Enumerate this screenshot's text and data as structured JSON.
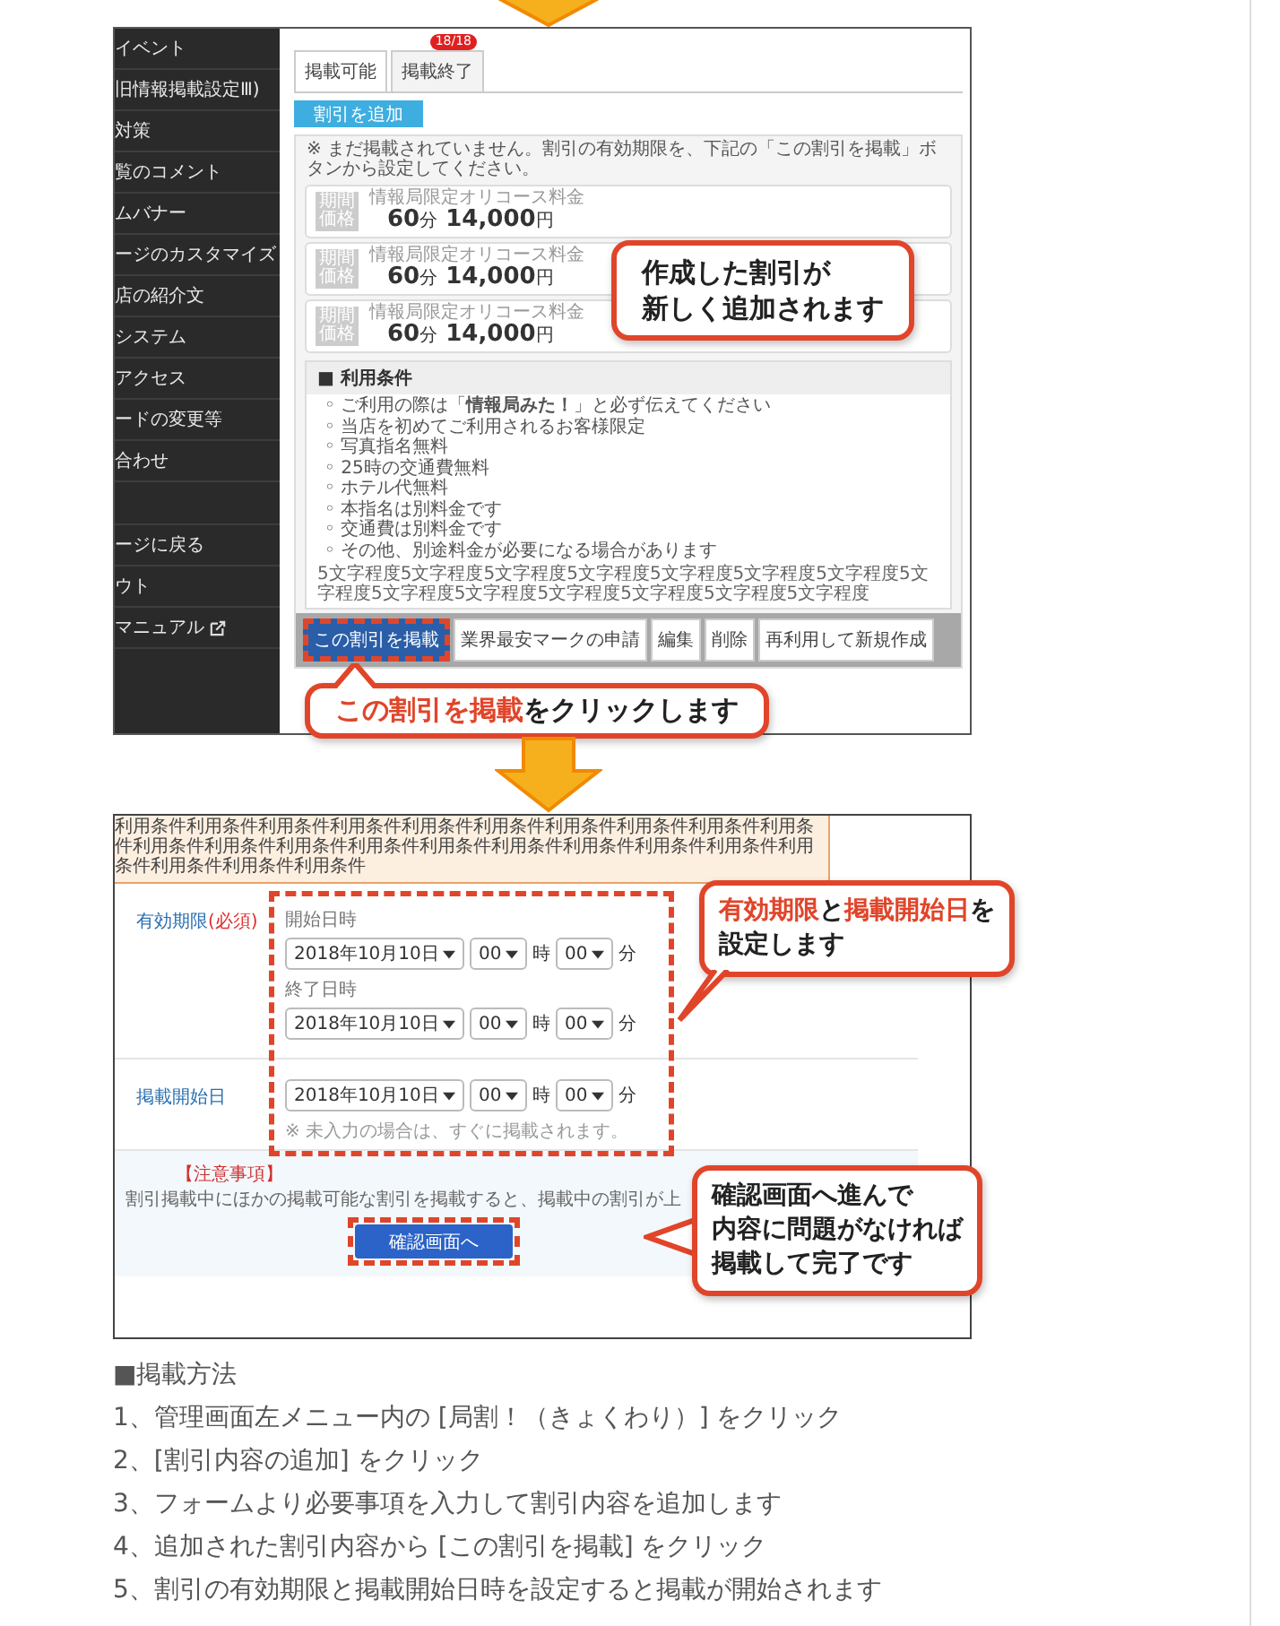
{
  "step1": {
    "sidebar": {
      "items": [
        {
          "label": "イベント"
        },
        {
          "label": "旧情報掲載設定Ⅲ)"
        },
        {
          "label": "対策"
        },
        {
          "label": "覧のコメント"
        },
        {
          "label": "ムバナー"
        },
        {
          "label": "ージのカスタマイズ"
        },
        {
          "label": "店の紹介文"
        },
        {
          "label": "システム"
        },
        {
          "label": "アクセス"
        },
        {
          "label": "ードの変更等"
        },
        {
          "label": "合わせ"
        },
        {
          "label": "ージに戻る",
          "gap_before": true
        },
        {
          "label": "ウト"
        },
        {
          "label": "マニュアル",
          "external": true
        }
      ]
    },
    "tabs": [
      {
        "label": "掲載可能",
        "selected": true
      },
      {
        "label": "掲載終了",
        "selected": false,
        "badge": "18/18"
      }
    ],
    "add_button": "割引を追加",
    "notice": "※ まだ掲載されていません。割引の有効期限を、下記の「この割引を掲載」ボタンから設定してください。",
    "discounts": [
      {
        "tag": [
          "期間",
          "価格"
        ],
        "title": "情報局限定オリコース料金",
        "minutes": "60",
        "minutes_unit": "分",
        "price": "14,000",
        "price_unit": "円"
      },
      {
        "tag": [
          "期間",
          "価格"
        ],
        "title": "情報局限定オリコース料金",
        "minutes": "60",
        "minutes_unit": "分",
        "price": "14,000",
        "price_unit": "円"
      },
      {
        "tag": [
          "期間",
          "価格"
        ],
        "title": "情報局限定オリコース料金",
        "minutes": "60",
        "minutes_unit": "分",
        "price": "14,000",
        "price_unit": "円"
      }
    ],
    "conditions": {
      "title": "■ 利用条件",
      "bullet": "◦",
      "items": [
        "ご利用の際は「**情報局みた！**」と必ず伝えてください",
        "当店を初めてご利用されるお客様限定",
        "写真指名無料",
        "25時の交通費無料",
        "ホテル代無料",
        "本指名は別料金です",
        "交通費は別料金です",
        "その他、別途料金が必要になる場合があります"
      ],
      "note": "5文字程度5文字程度5文字程度5文字程度5文字程度5文字程度5文字程度5文字程度5文字程度5文字程度5文字程度5文字程度5文字程度5文字程度"
    },
    "actions": [
      {
        "label": "この割引を掲載",
        "kind": "primary",
        "highlighted": true
      },
      {
        "label": "業界最安マークの申請",
        "kind": "plain",
        "highlighted": false
      },
      {
        "label": "編集",
        "kind": "plain",
        "highlighted": false
      },
      {
        "label": "削除",
        "kind": "plain",
        "highlighted": false
      },
      {
        "label": "再利用して新規作成",
        "kind": "plain",
        "highlighted": false
      }
    ],
    "callout_added": [
      "作成した割引が",
      "新しく追加されます"
    ],
    "callout_click": [
      {
        "text": "この割引を掲載",
        "accent": true
      },
      {
        "text": "をクリックします",
        "accent": false
      }
    ]
  },
  "step2": {
    "conditions_text": "利用条件利用条件利用条件利用条件利用条件利用条件利用条件利用条件利用条件利用条件利用条件利用条件利用条件利用条件利用条件利用条件利用条件利用条件利用条件利用条件利用条件利用条件利用条件",
    "validity": {
      "label": "有効期限",
      "required": "(必須)",
      "start": {
        "label": "開始日時",
        "date": "2018年10月10日",
        "hour": "00",
        "hour_unit": "時",
        "minute": "00",
        "minute_unit": "分"
      },
      "end": {
        "label": "終了日時",
        "date": "2018年10月10日",
        "hour": "00",
        "hour_unit": "時",
        "minute": "00",
        "minute_unit": "分"
      }
    },
    "publish": {
      "label": "掲載開始日",
      "date": "2018年10月10日",
      "hour": "00",
      "hour_unit": "時",
      "minute": "00",
      "minute_unit": "分",
      "note": "※ 未入力の場合は、すぐに掲載されます。"
    },
    "caution_title": "【注意事項】",
    "caution_text": "割引掲載中にほかの掲載可能な割引を掲載すると、掲載中の割引が上",
    "confirm_button": "確認画面へ",
    "callout_dates": [
      [
        {
          "text": "有効期限",
          "accent": true
        },
        {
          "text": "と",
          "accent": false
        },
        {
          "text": "掲載開始日",
          "accent": true
        },
        {
          "text": "を",
          "accent": false
        }
      ],
      [
        {
          "text": "設定します",
          "accent": false
        }
      ]
    ],
    "callout_confirm": [
      "確認画面へ進んで",
      "内容に問題がなければ",
      "掲載して完了です"
    ]
  },
  "howto": {
    "title": "■掲載方法",
    "steps": [
      "1、管理画面左メニュー内の [局割！（きょくわり）] をクリック",
      "2、[割引内容の追加] をクリック",
      "3、フォームより必要事項を入力して割引内容を追加します",
      "4、追加された割引内容から [この割引を掲載] をクリック",
      "5、割引の有効期限と掲載開始日時を設定すると掲載が開始されます"
    ]
  }
}
